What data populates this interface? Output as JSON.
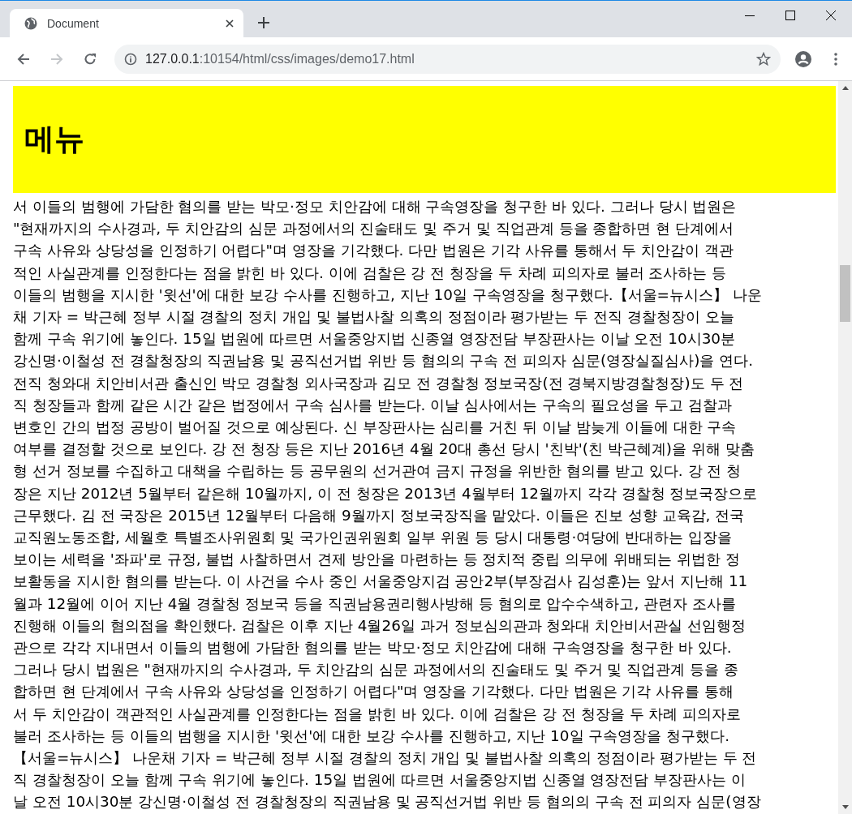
{
  "browser": {
    "tab_title": "Document",
    "url_host": "127.0.0.1",
    "url_path": ":10154/html/css/images/demo17.html",
    "back_enabled": true,
    "forward_enabled": false
  },
  "menu": {
    "title": "메뉴"
  },
  "article": {
    "lines": [
      "서 이들의 범행에 가담한 혐의를 받는 박모·정모 치안감에 대해 구속영장을 청구한 바 있다. 그러나 당시 법원은",
      "\"현재까지의 수사경과, 두 치안감의 심문 과정에서의 진술태도 및 주거 및 직업관계 등을 종합하면 현 단계에서",
      "구속 사유와 상당성을 인정하기 어렵다\"며 영장을 기각했다. 다만 법원은 기각 사유를 통해서 두 치안감이 객관",
      "적인 사실관계를 인정한다는 점을 밝힌 바 있다. 이에 검찰은 강 전 청장을 두 차례 피의자로 불러 조사하는 등",
      "이들의 범행을 지시한 '윗선'에 대한 보강 수사를 진행하고, 지난 10일 구속영장을 청구했다.【서울=뉴시스】 나운",
      "채 기자 = 박근혜 정부 시절 경찰의 정치 개입 및 불법사찰 의혹의 정점이라 평가받는 두 전직 경찰청장이 오늘",
      "함께 구속 위기에 놓인다. 15일 법원에 따르면 서울중앙지법 신종열 영장전담 부장판사는 이날 오전 10시30분",
      "강신명·이철성 전 경찰청장의 직권남용 및 공직선거법 위반 등 혐의의 구속 전 피의자 심문(영장실질심사)을 연다.",
      "전직 청와대 치안비서관 출신인 박모 경찰청 외사국장과 김모 전 경찰청 정보국장(전 경북지방경찰청장)도 두 전",
      "직 청장들과 함께 같은 시간 같은 법정에서 구속 심사를 받는다. 이날 심사에서는 구속의 필요성을 두고 검찰과",
      "변호인 간의 법정 공방이 벌어질 것으로 예상된다. 신 부장판사는 심리를 거친 뒤 이날 밤늦게 이들에 대한 구속",
      "여부를 결정할 것으로 보인다. 강 전 청장 등은 지난 2016년 4월 20대 총선 당시 '친박'(친 박근혜계)을 위해 맞춤",
      "형 선거 정보를 수집하고 대책을 수립하는 등 공무원의 선거관여 금지 규정을 위반한 혐의를 받고 있다. 강 전 청",
      "장은 지난 2012년 5월부터 같은해 10월까지, 이 전 청장은 2013년 4월부터 12월까지 각각 경찰청 정보국장으로",
      "근무했다. 김 전 국장은 2015년 12월부터 다음해 9월까지 정보국장직을 맡았다. 이들은 진보 성향 교육감, 전국",
      "교직원노동조합, 세월호 특별조사위원회 및 국가인권위원회 일부 위원 등 당시 대통령·여당에 반대하는 입장을",
      "보이는 세력을 '좌파'로 규정, 불법 사찰하면서 견제 방안을 마련하는 등 정치적 중립 의무에 위배되는 위법한 정",
      "보활동을 지시한 혐의를 받는다. 이 사건을 수사 중인 서울중앙지검 공안2부(부장검사 김성훈)는 앞서 지난해 11",
      "월과 12월에 이어 지난 4월 경찰청 정보국 등을 직권남용권리행사방해 등 혐의로 압수수색하고, 관련자 조사를",
      "진행해 이들의 혐의점을 확인했다. 검찰은 이후 지난 4월26일 과거 정보심의관과 청와대 치안비서관실 선임행정",
      "관으로 각각 지내면서 이들의 범행에 가담한 혐의를 받는 박모·정모 치안감에 대해 구속영장을 청구한 바 있다.",
      "그러나 당시 법원은 \"현재까지의 수사경과, 두 치안감의 심문 과정에서의 진술태도 및 주거 및 직업관계 등을 종",
      "합하면 현 단계에서 구속 사유와 상당성을 인정하기 어렵다\"며 영장을 기각했다. 다만 법원은 기각 사유를 통해",
      "서 두 치안감이 객관적인 사실관계를 인정한다는 점을 밝힌 바 있다. 이에 검찰은 강 전 청장을 두 차례 피의자로",
      "불러 조사하는 등 이들의 범행을 지시한 '윗선'에 대한 보강 수사를 진행하고, 지난 10일 구속영장을 청구했다.",
      "【서울=뉴시스】 나운채 기자 = 박근혜 정부 시절 경찰의 정치 개입 및 불법사찰 의혹의 정점이라 평가받는 두 전",
      "직 경찰청장이 오늘 함께 구속 위기에 놓인다. 15일 법원에 따르면 서울중앙지법 신종열 영장전담 부장판사는 이",
      "날 오전 10시30분 강신명·이철성 전 경찰청장의 직권남용 및 공직선거법 위반 등 혐의의 구속 전 피의자 심문(영장"
    ]
  }
}
